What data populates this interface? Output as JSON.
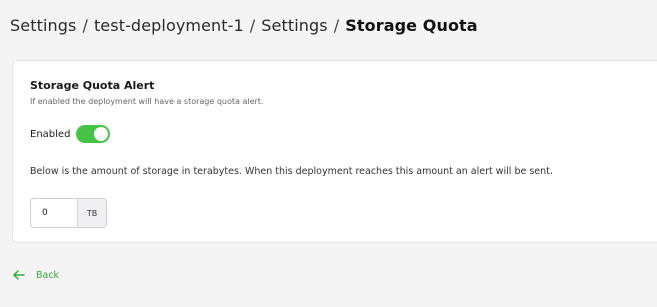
{
  "breadcrumb": {
    "items": [
      "Settings",
      "test-deployment-1",
      "Settings"
    ],
    "separator": "/",
    "current": "Storage Quota"
  },
  "card": {
    "title": "Storage Quota Alert",
    "subtitle": "If enabled the deployment will have a storage quota alert.",
    "toggle": {
      "label": "Enabled",
      "state": "on",
      "color": "#46c246"
    },
    "description": "Below is the amount of storage in terabytes. When this deployment reaches this amount an alert will be sent.",
    "quota": {
      "value": "0",
      "unit": "TB"
    }
  },
  "back": {
    "label": "Back",
    "icon": "arrow-left-icon",
    "color": "#3aa83a"
  }
}
